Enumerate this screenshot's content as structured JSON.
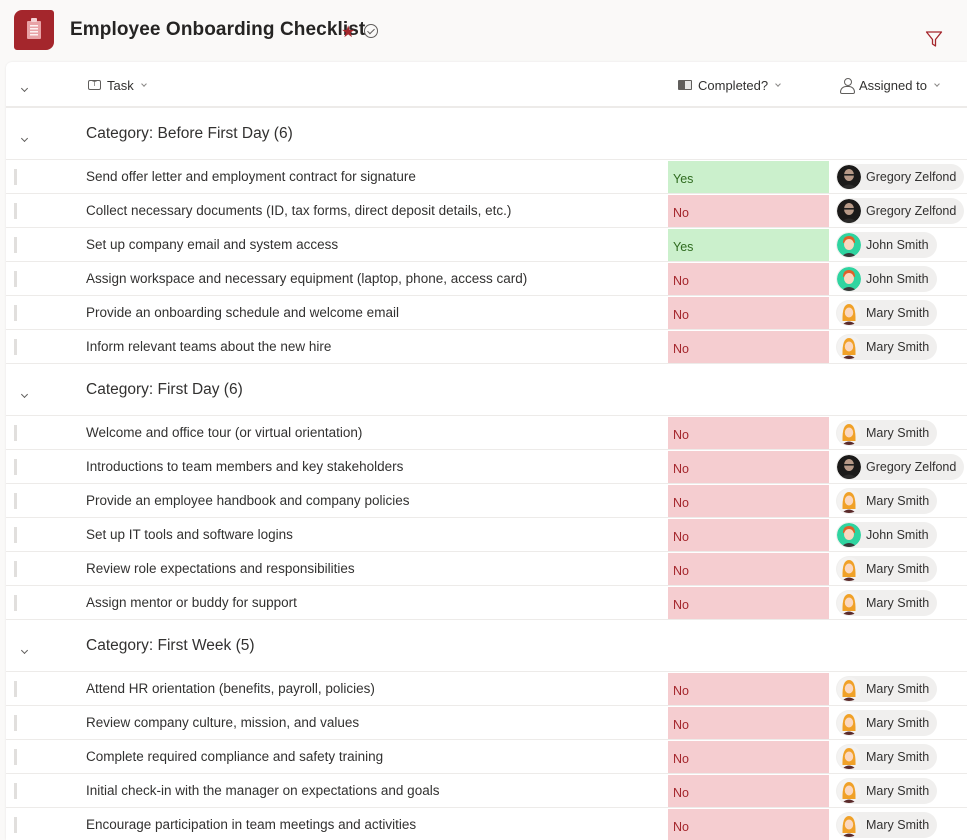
{
  "header": {
    "title": "Employee Onboarding Checklist",
    "favorite_icon": "star-icon",
    "status_icon": "check-circle-icon",
    "filter_icon": "filter-icon",
    "accent_color": "#a4262c"
  },
  "columns": [
    {
      "label": "Task",
      "icon": "text-type-icon"
    },
    {
      "label": "Completed?",
      "icon": "yes-no-type-icon"
    },
    {
      "label": "Assigned to",
      "icon": "person-type-icon"
    }
  ],
  "status_colors": {
    "Yes": "#cbf0cc",
    "No": "#f5cdd0"
  },
  "groups": [
    {
      "title": "Category: Before First Day (6)",
      "rows": [
        {
          "task": "Send offer letter and employment contract for signature",
          "completed": "Yes",
          "assigned": "Gregory Zelfond"
        },
        {
          "task": "Collect necessary documents (ID, tax forms, direct deposit details, etc.)",
          "completed": "No",
          "assigned": "Gregory Zelfond"
        },
        {
          "task": "Set up company email and system access",
          "completed": "Yes",
          "assigned": "John Smith"
        },
        {
          "task": "Assign workspace and necessary equipment (laptop, phone, access card)",
          "completed": "No",
          "assigned": "John Smith"
        },
        {
          "task": "Provide an onboarding schedule and welcome email",
          "completed": "No",
          "assigned": "Mary Smith"
        },
        {
          "task": "Inform relevant teams about the new hire",
          "completed": "No",
          "assigned": "Mary Smith"
        }
      ]
    },
    {
      "title": "Category: First Day (6)",
      "rows": [
        {
          "task": "Welcome and office tour (or virtual orientation)",
          "completed": "No",
          "assigned": "Mary Smith"
        },
        {
          "task": "Introductions to team members and key stakeholders",
          "completed": "No",
          "assigned": "Gregory Zelfond"
        },
        {
          "task": "Provide an employee handbook and company policies",
          "completed": "No",
          "assigned": "Mary Smith"
        },
        {
          "task": "Set up IT tools and software logins",
          "completed": "No",
          "assigned": "John Smith"
        },
        {
          "task": "Review role expectations and responsibilities",
          "completed": "No",
          "assigned": "Mary Smith"
        },
        {
          "task": "Assign mentor or buddy for support",
          "completed": "No",
          "assigned": "Mary Smith"
        }
      ]
    },
    {
      "title": "Category: First Week (5)",
      "rows": [
        {
          "task": "Attend HR orientation (benefits, payroll, policies)",
          "completed": "No",
          "assigned": "Mary Smith"
        },
        {
          "task": "Review company culture, mission, and values",
          "completed": "No",
          "assigned": "Mary Smith"
        },
        {
          "task": "Complete required compliance and safety training",
          "completed": "No",
          "assigned": "Mary Smith"
        },
        {
          "task": "Initial check-in with the manager on expectations and goals",
          "completed": "No",
          "assigned": "Mary Smith"
        },
        {
          "task": "Encourage participation in team meetings and activities",
          "completed": "No",
          "assigned": "Mary Smith"
        }
      ]
    }
  ]
}
